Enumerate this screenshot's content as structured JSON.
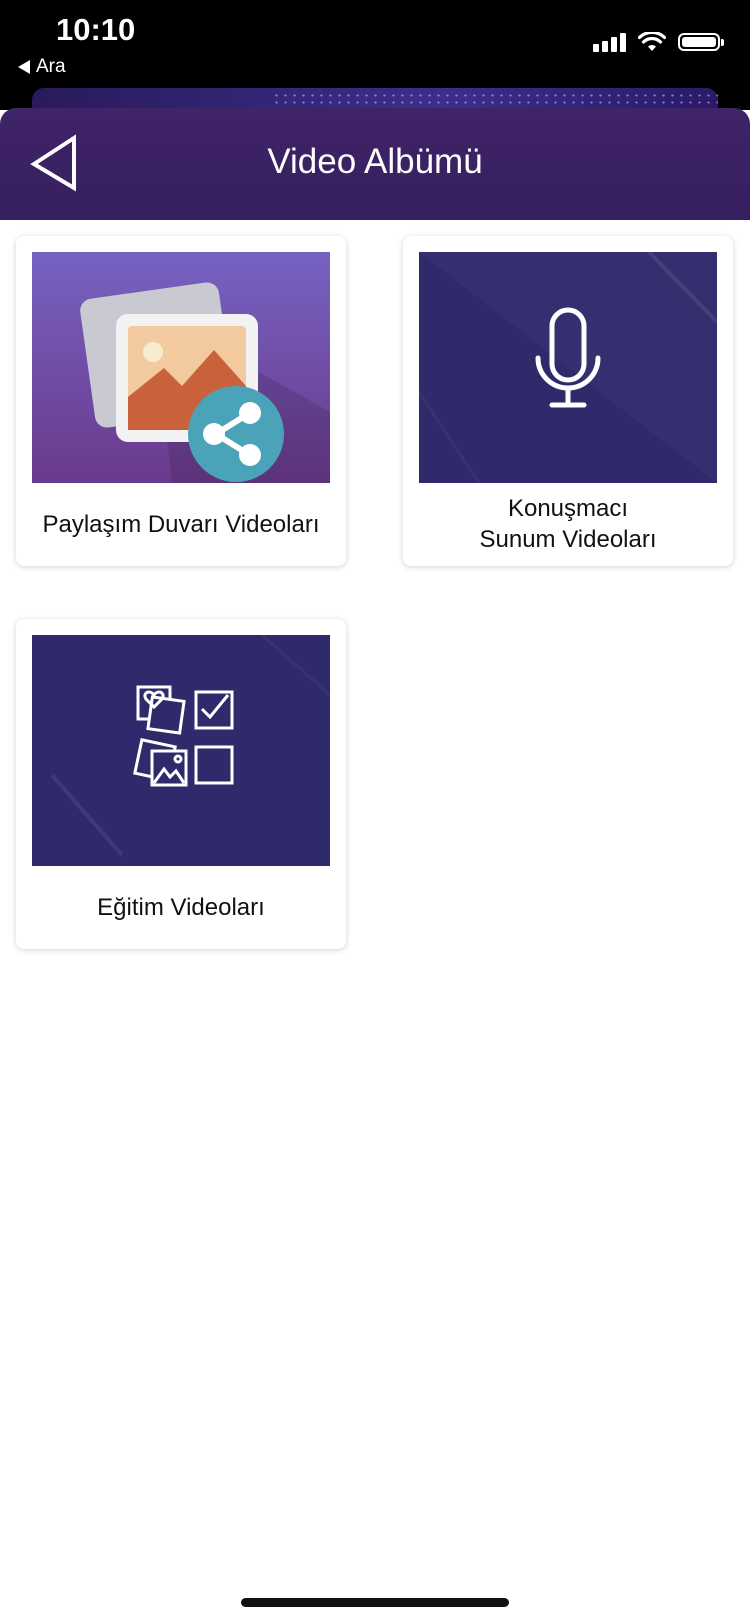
{
  "status_bar": {
    "time": "10:10",
    "back_app": "Ara"
  },
  "header": {
    "title": "Video Albümü",
    "back_icon": "back-triangle-icon"
  },
  "cards": [
    {
      "label": "Paylaşım Duvarı Videoları",
      "icon": "photo-share-icon"
    },
    {
      "label": "Konuşmacı\nSunum Videoları",
      "icon": "microphone-icon"
    },
    {
      "label": "Eğitim Videoları",
      "icon": "training-grid-icon"
    }
  ],
  "colors": {
    "header": "#3b2164",
    "thumb_dark": "#2e2a6b",
    "share": "#4aa3b8"
  }
}
